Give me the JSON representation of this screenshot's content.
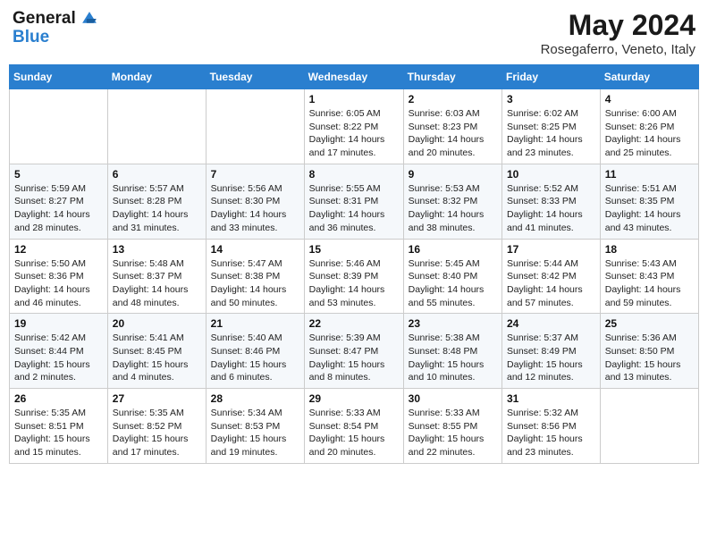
{
  "header": {
    "logo_line1": "General",
    "logo_line2": "Blue",
    "month_year": "May 2024",
    "location": "Rosegaferro, Veneto, Italy"
  },
  "days_of_week": [
    "Sunday",
    "Monday",
    "Tuesday",
    "Wednesday",
    "Thursday",
    "Friday",
    "Saturday"
  ],
  "weeks": [
    [
      {
        "day": "",
        "info": ""
      },
      {
        "day": "",
        "info": ""
      },
      {
        "day": "",
        "info": ""
      },
      {
        "day": "1",
        "info": "Sunrise: 6:05 AM\nSunset: 8:22 PM\nDaylight: 14 hours\nand 17 minutes."
      },
      {
        "day": "2",
        "info": "Sunrise: 6:03 AM\nSunset: 8:23 PM\nDaylight: 14 hours\nand 20 minutes."
      },
      {
        "day": "3",
        "info": "Sunrise: 6:02 AM\nSunset: 8:25 PM\nDaylight: 14 hours\nand 23 minutes."
      },
      {
        "day": "4",
        "info": "Sunrise: 6:00 AM\nSunset: 8:26 PM\nDaylight: 14 hours\nand 25 minutes."
      }
    ],
    [
      {
        "day": "5",
        "info": "Sunrise: 5:59 AM\nSunset: 8:27 PM\nDaylight: 14 hours\nand 28 minutes."
      },
      {
        "day": "6",
        "info": "Sunrise: 5:57 AM\nSunset: 8:28 PM\nDaylight: 14 hours\nand 31 minutes."
      },
      {
        "day": "7",
        "info": "Sunrise: 5:56 AM\nSunset: 8:30 PM\nDaylight: 14 hours\nand 33 minutes."
      },
      {
        "day": "8",
        "info": "Sunrise: 5:55 AM\nSunset: 8:31 PM\nDaylight: 14 hours\nand 36 minutes."
      },
      {
        "day": "9",
        "info": "Sunrise: 5:53 AM\nSunset: 8:32 PM\nDaylight: 14 hours\nand 38 minutes."
      },
      {
        "day": "10",
        "info": "Sunrise: 5:52 AM\nSunset: 8:33 PM\nDaylight: 14 hours\nand 41 minutes."
      },
      {
        "day": "11",
        "info": "Sunrise: 5:51 AM\nSunset: 8:35 PM\nDaylight: 14 hours\nand 43 minutes."
      }
    ],
    [
      {
        "day": "12",
        "info": "Sunrise: 5:50 AM\nSunset: 8:36 PM\nDaylight: 14 hours\nand 46 minutes."
      },
      {
        "day": "13",
        "info": "Sunrise: 5:48 AM\nSunset: 8:37 PM\nDaylight: 14 hours\nand 48 minutes."
      },
      {
        "day": "14",
        "info": "Sunrise: 5:47 AM\nSunset: 8:38 PM\nDaylight: 14 hours\nand 50 minutes."
      },
      {
        "day": "15",
        "info": "Sunrise: 5:46 AM\nSunset: 8:39 PM\nDaylight: 14 hours\nand 53 minutes."
      },
      {
        "day": "16",
        "info": "Sunrise: 5:45 AM\nSunset: 8:40 PM\nDaylight: 14 hours\nand 55 minutes."
      },
      {
        "day": "17",
        "info": "Sunrise: 5:44 AM\nSunset: 8:42 PM\nDaylight: 14 hours\nand 57 minutes."
      },
      {
        "day": "18",
        "info": "Sunrise: 5:43 AM\nSunset: 8:43 PM\nDaylight: 14 hours\nand 59 minutes."
      }
    ],
    [
      {
        "day": "19",
        "info": "Sunrise: 5:42 AM\nSunset: 8:44 PM\nDaylight: 15 hours\nand 2 minutes."
      },
      {
        "day": "20",
        "info": "Sunrise: 5:41 AM\nSunset: 8:45 PM\nDaylight: 15 hours\nand 4 minutes."
      },
      {
        "day": "21",
        "info": "Sunrise: 5:40 AM\nSunset: 8:46 PM\nDaylight: 15 hours\nand 6 minutes."
      },
      {
        "day": "22",
        "info": "Sunrise: 5:39 AM\nSunset: 8:47 PM\nDaylight: 15 hours\nand 8 minutes."
      },
      {
        "day": "23",
        "info": "Sunrise: 5:38 AM\nSunset: 8:48 PM\nDaylight: 15 hours\nand 10 minutes."
      },
      {
        "day": "24",
        "info": "Sunrise: 5:37 AM\nSunset: 8:49 PM\nDaylight: 15 hours\nand 12 minutes."
      },
      {
        "day": "25",
        "info": "Sunrise: 5:36 AM\nSunset: 8:50 PM\nDaylight: 15 hours\nand 13 minutes."
      }
    ],
    [
      {
        "day": "26",
        "info": "Sunrise: 5:35 AM\nSunset: 8:51 PM\nDaylight: 15 hours\nand 15 minutes."
      },
      {
        "day": "27",
        "info": "Sunrise: 5:35 AM\nSunset: 8:52 PM\nDaylight: 15 hours\nand 17 minutes."
      },
      {
        "day": "28",
        "info": "Sunrise: 5:34 AM\nSunset: 8:53 PM\nDaylight: 15 hours\nand 19 minutes."
      },
      {
        "day": "29",
        "info": "Sunrise: 5:33 AM\nSunset: 8:54 PM\nDaylight: 15 hours\nand 20 minutes."
      },
      {
        "day": "30",
        "info": "Sunrise: 5:33 AM\nSunset: 8:55 PM\nDaylight: 15 hours\nand 22 minutes."
      },
      {
        "day": "31",
        "info": "Sunrise: 5:32 AM\nSunset: 8:56 PM\nDaylight: 15 hours\nand 23 minutes."
      },
      {
        "day": "",
        "info": ""
      }
    ]
  ]
}
